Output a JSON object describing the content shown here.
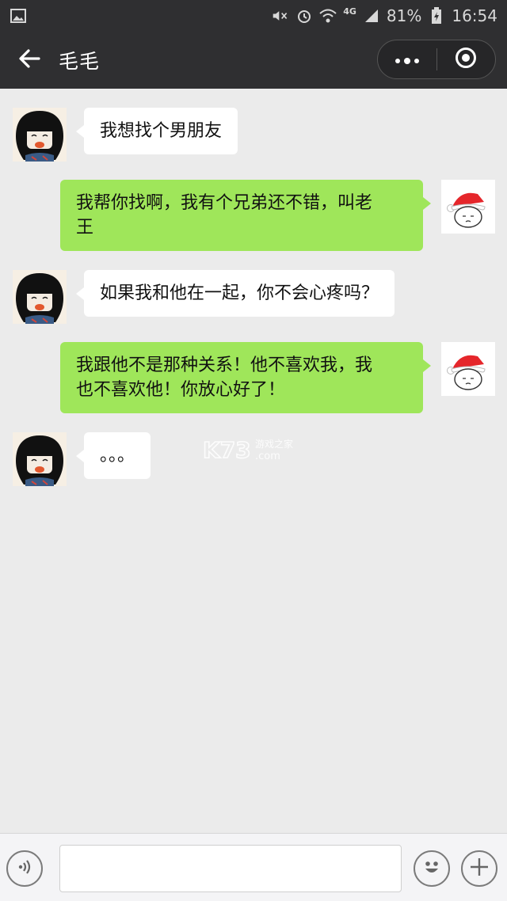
{
  "status_bar": {
    "network": "4G",
    "battery": "81%",
    "time": "16:54",
    "icons": [
      "image-icon",
      "mute-icon",
      "alarm-icon",
      "wifi-icon",
      "signal-icon",
      "battery-icon"
    ]
  },
  "header": {
    "title": "毛毛",
    "back_icon": "arrow-left-icon",
    "more_icon": "more-dots-icon",
    "close_icon": "target-close-icon"
  },
  "messages": [
    {
      "from": "other",
      "text": "我想找个男朋友"
    },
    {
      "from": "me",
      "lines": [
        "我帮你找啊，我有个兄弟还不错，叫老",
        "王"
      ]
    },
    {
      "from": "other",
      "text": "如果我和他在一起，你不会心疼吗？"
    },
    {
      "from": "me",
      "lines": [
        "我跟他不是那种关系！他不喜欢我，我",
        "也不喜欢他！你放心好了！"
      ]
    },
    {
      "from": "other",
      "text": "。。。"
    }
  ],
  "watermark": {
    "brand": "K73",
    "sub": "游戏之家",
    "domain": ".com"
  },
  "input_bar": {
    "placeholder": "",
    "voice_icon": "voice-icon",
    "emoji_icon": "emoji-icon",
    "plus_icon": "plus-icon"
  },
  "colors": {
    "header_bg": "#2f2f31",
    "chat_bg": "#ebebeb",
    "out_bubble": "#9fe65a",
    "in_bubble": "#ffffff"
  }
}
